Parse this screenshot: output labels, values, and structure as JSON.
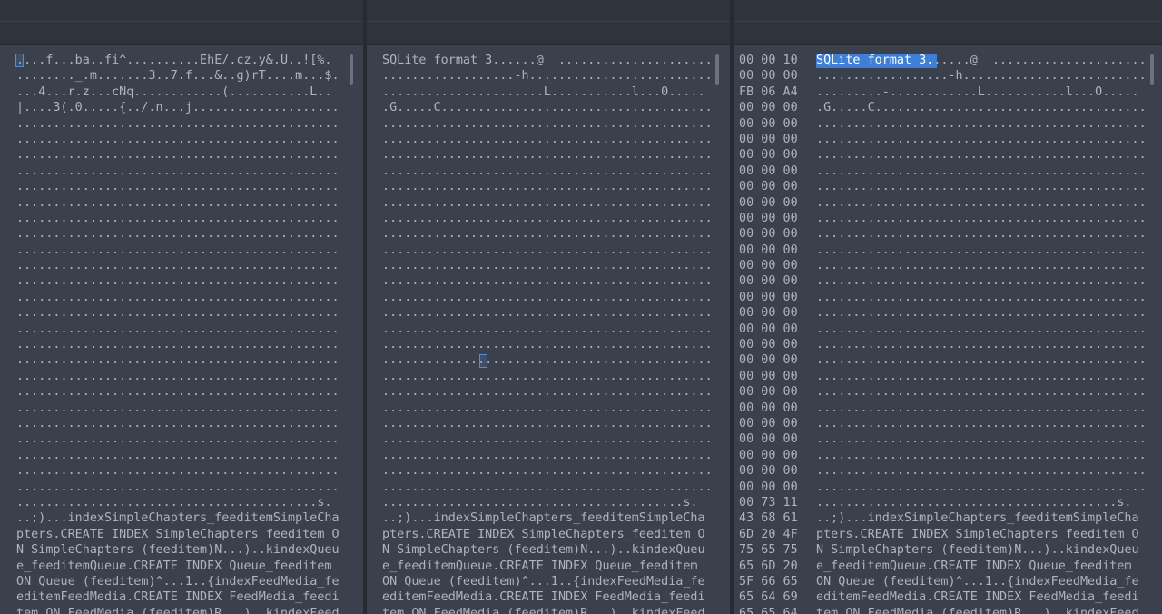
{
  "panes": {
    "left": {
      "lines": [
        "....f...ba..fi^..........EhE/.cz.y&.U..![%.",
        "........_.m.......3..7.f...&..g)rT....m...$.",
        "...4...r.z...cNq............(...........L..",
        "|....3(.0.....{../.n...j....................",
        "............................................",
        "............................................",
        "............................................",
        "............................................",
        "............................................",
        "............................................",
        "............................................",
        "............................................",
        "............................................",
        "............................................",
        "............................................",
        "............................................",
        "............................................",
        "............................................",
        "............................................",
        "............................................",
        "............................................",
        "............................................",
        "............................................",
        "............................................",
        "............................................",
        "............................................",
        "............................................",
        "............................................",
        ".........................................s.",
        "..;)...indexSimpleChapters_feeditemSimpleCha",
        "pters.CREATE INDEX SimpleChapters_feeditem O",
        "N SimpleChapters (feeditem)N...)..kindexQueu",
        "e_feeditemQueue.CREATE INDEX Queue_feeditem ",
        "ON Queue (feeditem)^...1..{indexFeedMedia_fe",
        "editemFeedMedia.CREATE INDEX FeedMedia_feedi",
        "tem ON FeedMedia (feeditem)R...)..kindexFeed"
      ]
    },
    "middle": {
      "lines": [
        "SQLite format 3......@  .....................",
        "..................-h.........................",
        "......................L...........l...0.....",
        ".G.....C.....................................",
        ".............................................",
        ".............................................",
        ".............................................",
        ".............................................",
        ".............................................",
        ".............................................",
        ".............................................",
        ".............................................",
        ".............................................",
        ".............................................",
        ".............................................",
        ".............................................",
        ".............................................",
        ".............................................",
        ".............................................",
        ".............................................",
        ".............................................",
        ".............................................",
        ".............................................",
        ".............................................",
        ".............................................",
        ".............................................",
        ".............................................",
        ".............................................",
        ".........................................s.",
        "..;)...indexSimpleChapters_feeditemSimpleCha",
        "pters.CREATE INDEX SimpleChapters_feeditem O",
        "N SimpleChapters (feeditem)N...)..kindexQueu",
        "e_feeditemQueue.CREATE INDEX Queue_feeditem ",
        "ON Queue (feeditem)^...1..{indexFeedMedia_fe",
        "editemFeedMedia.CREATE INDEX FeedMedia_feedi",
        "tem ON FeedMedia (feeditem)R...)..kindexFeed"
      ]
    },
    "right": {
      "hex": [
        "00 00 10",
        "00 00 00",
        "FB 06 A4",
        "00 00 00",
        "00 00 00",
        "00 00 00",
        "00 00 00",
        "00 00 00",
        "00 00 00",
        "00 00 00",
        "00 00 00",
        "00 00 00",
        "00 00 00",
        "00 00 00",
        "00 00 00",
        "00 00 00",
        "00 00 00",
        "00 00 00",
        "00 00 00",
        "00 00 00",
        "00 00 00",
        "00 00 00",
        "00 00 00",
        "00 00 00",
        "00 00 00",
        "00 00 00",
        "00 00 00",
        "00 00 00",
        "00 73 11",
        "43 68 61",
        "6D 20 4F",
        "75 65 75",
        "65 6D 20",
        "5F 66 65",
        "65 64 69",
        "65 65 64"
      ],
      "lines": [
        "SQLite format 3......@  .....................",
        "..................-h.........................",
        ".........-............L...........l...O.....",
        ".G.....C.....................................",
        ".............................................",
        ".............................................",
        ".............................................",
        ".............................................",
        ".............................................",
        ".............................................",
        ".............................................",
        ".............................................",
        ".............................................",
        ".............................................",
        ".............................................",
        ".............................................",
        ".............................................",
        ".............................................",
        ".............................................",
        ".............................................",
        ".............................................",
        ".............................................",
        ".............................................",
        ".............................................",
        ".............................................",
        ".............................................",
        ".............................................",
        ".............................................",
        ".........................................s.",
        "..;)...indexSimpleChapters_feeditemSimpleCha",
        "pters.CREATE INDEX SimpleChapters_feeditem O",
        "N SimpleChapters (feeditem)N...)..kindexQueu",
        "e_feeditemQueue.CREATE INDEX Queue_feeditem ",
        "ON Queue (feeditem)^...1..{indexFeedMedia_fe",
        "editemFeedMedia.CREATE INDEX FeedMedia_feedi",
        "tem ON FeedMedia (feeditem)R...)..kindexFeed"
      ]
    }
  },
  "colors": {
    "background": "#3b414c",
    "header": "#2e333c",
    "text": "#aeb3bc",
    "selection": "#3f7fd6",
    "cursor": "#4f8ee0"
  }
}
